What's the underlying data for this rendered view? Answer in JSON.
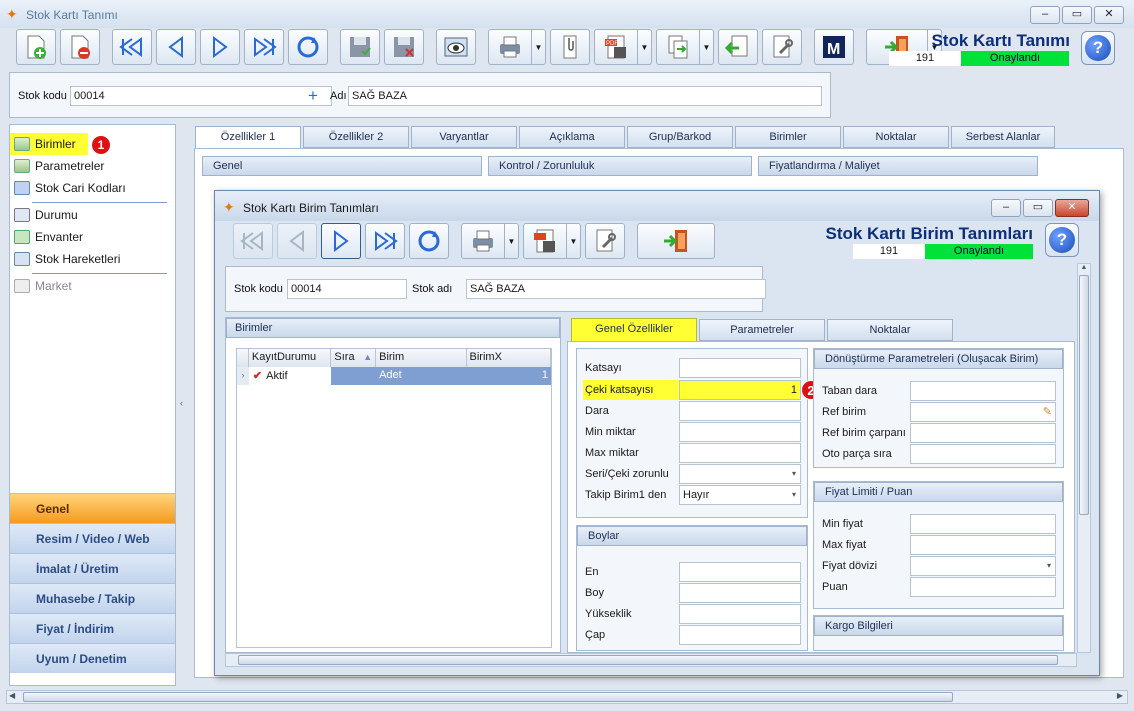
{
  "window": {
    "title": "Stok Kartı Tanımı"
  },
  "header": {
    "title": "Stok Kartı Tanımı",
    "number": "191",
    "status": "Onaylandı"
  },
  "stock": {
    "code_label": "Stok kodu",
    "code_value": "00014",
    "name_label": "Adı",
    "name_value": "SAĞ BAZA"
  },
  "sidebar": {
    "items": [
      {
        "label": "Birimler",
        "badge": "1"
      },
      {
        "label": "Parametreler"
      },
      {
        "label": "Stok Cari Kodları"
      },
      {
        "label": "Durumu"
      },
      {
        "label": "Envanter"
      },
      {
        "label": "Stok Hareketleri"
      },
      {
        "label": "Market"
      }
    ],
    "groups": [
      "Genel",
      "Resim / Video / Web",
      "İmalat / Üretim",
      "Muhasebe / Takip",
      "Fiyat / İndirim",
      "Uyum / Denetim"
    ]
  },
  "main_tabs": [
    "Özellikler 1",
    "Özellikler 2",
    "Varyantlar",
    "Açıklama",
    "Grup/Barkod",
    "Birimler",
    "Noktalar",
    "Serbest Alanlar"
  ],
  "main_sections": [
    "Genel",
    "Kontrol / Zorunluluk",
    "Fiyatlandırma / Maliyet"
  ],
  "dialog": {
    "title": "Stok Kartı Birim Tanımları",
    "header_title": "Stok Kartı Birim Tanımları",
    "number": "191",
    "status": "Onaylandı",
    "stock_code_label": "Stok kodu",
    "stock_code_value": "00014",
    "stock_name_label": "Stok adı",
    "stock_name_value": "SAĞ BAZA",
    "units_panel": "Birimler",
    "grid_headers": [
      "KayıtDurumu",
      "Sıra",
      "Birim",
      "BirimX"
    ],
    "grid_row": {
      "status": "Aktif",
      "unit": "Adet",
      "unitx": "1"
    },
    "tabs": [
      "Genel Özellikler",
      "Parametreler",
      "Noktalar"
    ],
    "fields": {
      "katsayi": "Katsayı",
      "ceki": "Çeki katsayısı",
      "ceki_value": "1",
      "dara": "Dara",
      "min": "Min miktar",
      "max": "Max miktar",
      "seri": "Seri/Çeki zorunlu",
      "takip": "Takip Birim1 den",
      "takip_value": "Hayır"
    },
    "badge2": "2",
    "boylar": {
      "title": "Boylar",
      "en": "En",
      "boy": "Boy",
      "yukseklik": "Yükseklik",
      "cap": "Çap"
    },
    "donusturme": {
      "title": "Dönüştürme Parametreleri (Oluşacak Birim)",
      "taban": "Taban dara",
      "ref": "Ref birim",
      "carpan": "Ref birim çarpanı",
      "oto": "Oto parça sıra"
    },
    "fiyat": {
      "title": "Fiyat Limiti / Puan",
      "min": "Min fiyat",
      "max": "Max fiyat",
      "doviz": "Fiyat dövizi",
      "puan": "Puan"
    },
    "kargo": {
      "title": "Kargo Bilgileri"
    }
  },
  "colors": {
    "accent": "#00e13a",
    "highlight": "#ffff33",
    "badge": "#e01010"
  }
}
